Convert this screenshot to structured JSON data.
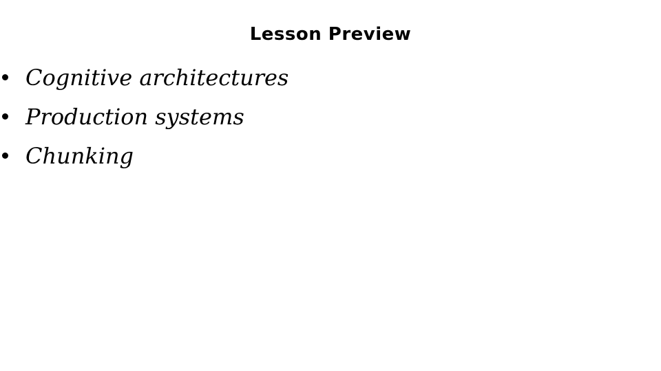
{
  "slide": {
    "title": "Lesson Preview",
    "bullets": [
      "Cognitive architectures",
      "Production systems",
      "Chunking"
    ]
  }
}
